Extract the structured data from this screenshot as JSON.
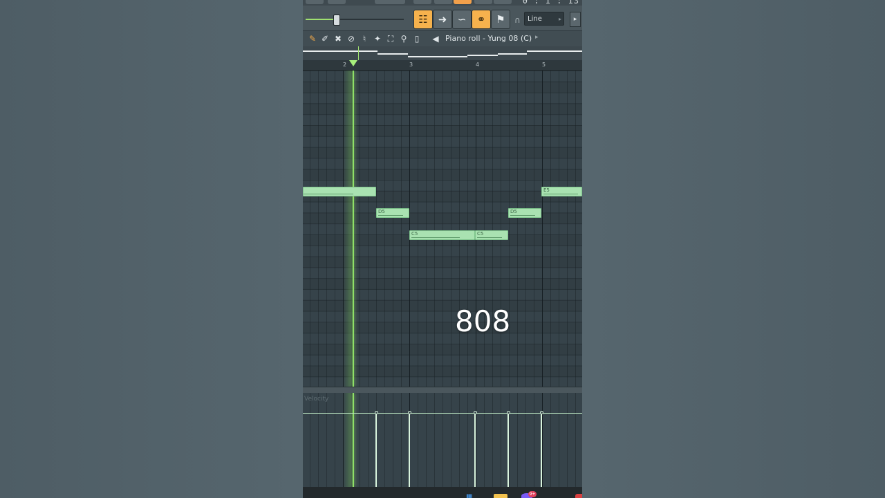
{
  "header": {
    "time_digits": "0 : 1 : 13",
    "snap_value": "Line"
  },
  "toolbar": {
    "window_title": "Piano roll - Yung 08 (C)"
  },
  "ruler": {
    "bars": [
      "2",
      "3",
      "4",
      "5"
    ]
  },
  "notes": [
    {
      "label": ""
    },
    {
      "label": "D5"
    },
    {
      "label": "C5"
    },
    {
      "label": "C5"
    },
    {
      "label": "D5"
    },
    {
      "label": "E5"
    }
  ],
  "overlay": {
    "caption": "808"
  },
  "event_editor": {
    "label": "Velocity"
  },
  "taskbar": {
    "badge": "9+"
  },
  "colors": {
    "accent": "#f6b24d",
    "note_fill": "#a9e2b1",
    "playhead": "#8fe066"
  }
}
